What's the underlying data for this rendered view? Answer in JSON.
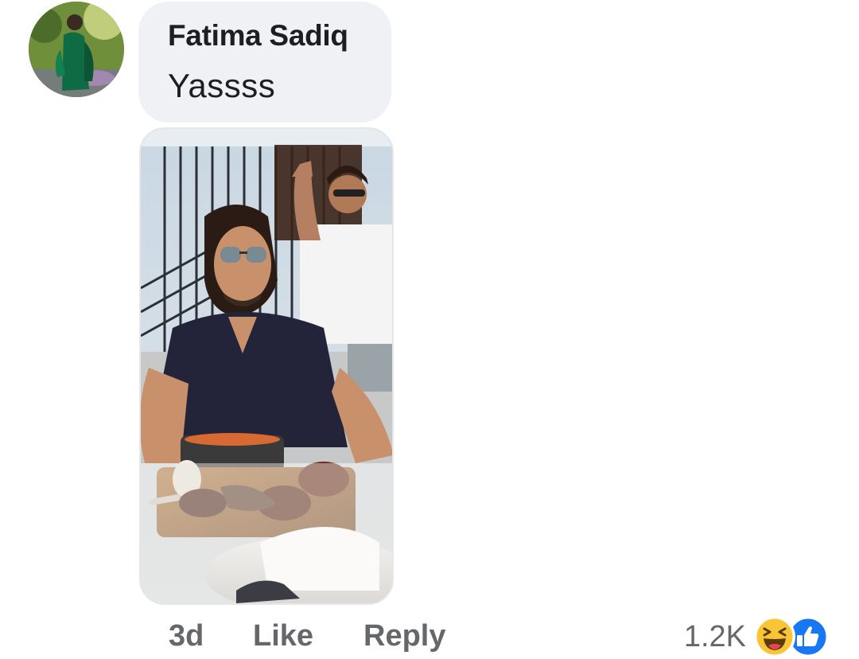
{
  "comment": {
    "author": "Fatima Sadiq",
    "text": "Yassss",
    "avatar_icon": "profile-photo",
    "attachment_icon": "photo-attachment"
  },
  "actions": {
    "time": "3d",
    "like_label": "Like",
    "reply_label": "Reply"
  },
  "reactions": {
    "count": "1.2K",
    "icons": [
      "haha-reaction-icon",
      "like-reaction-icon"
    ],
    "colors": {
      "haha": "#f7c536",
      "like": "#1877f2"
    }
  },
  "colors": {
    "bubble": "#eff1f4",
    "secondary_text": "#65676b",
    "primary_text": "#1c1e21"
  }
}
